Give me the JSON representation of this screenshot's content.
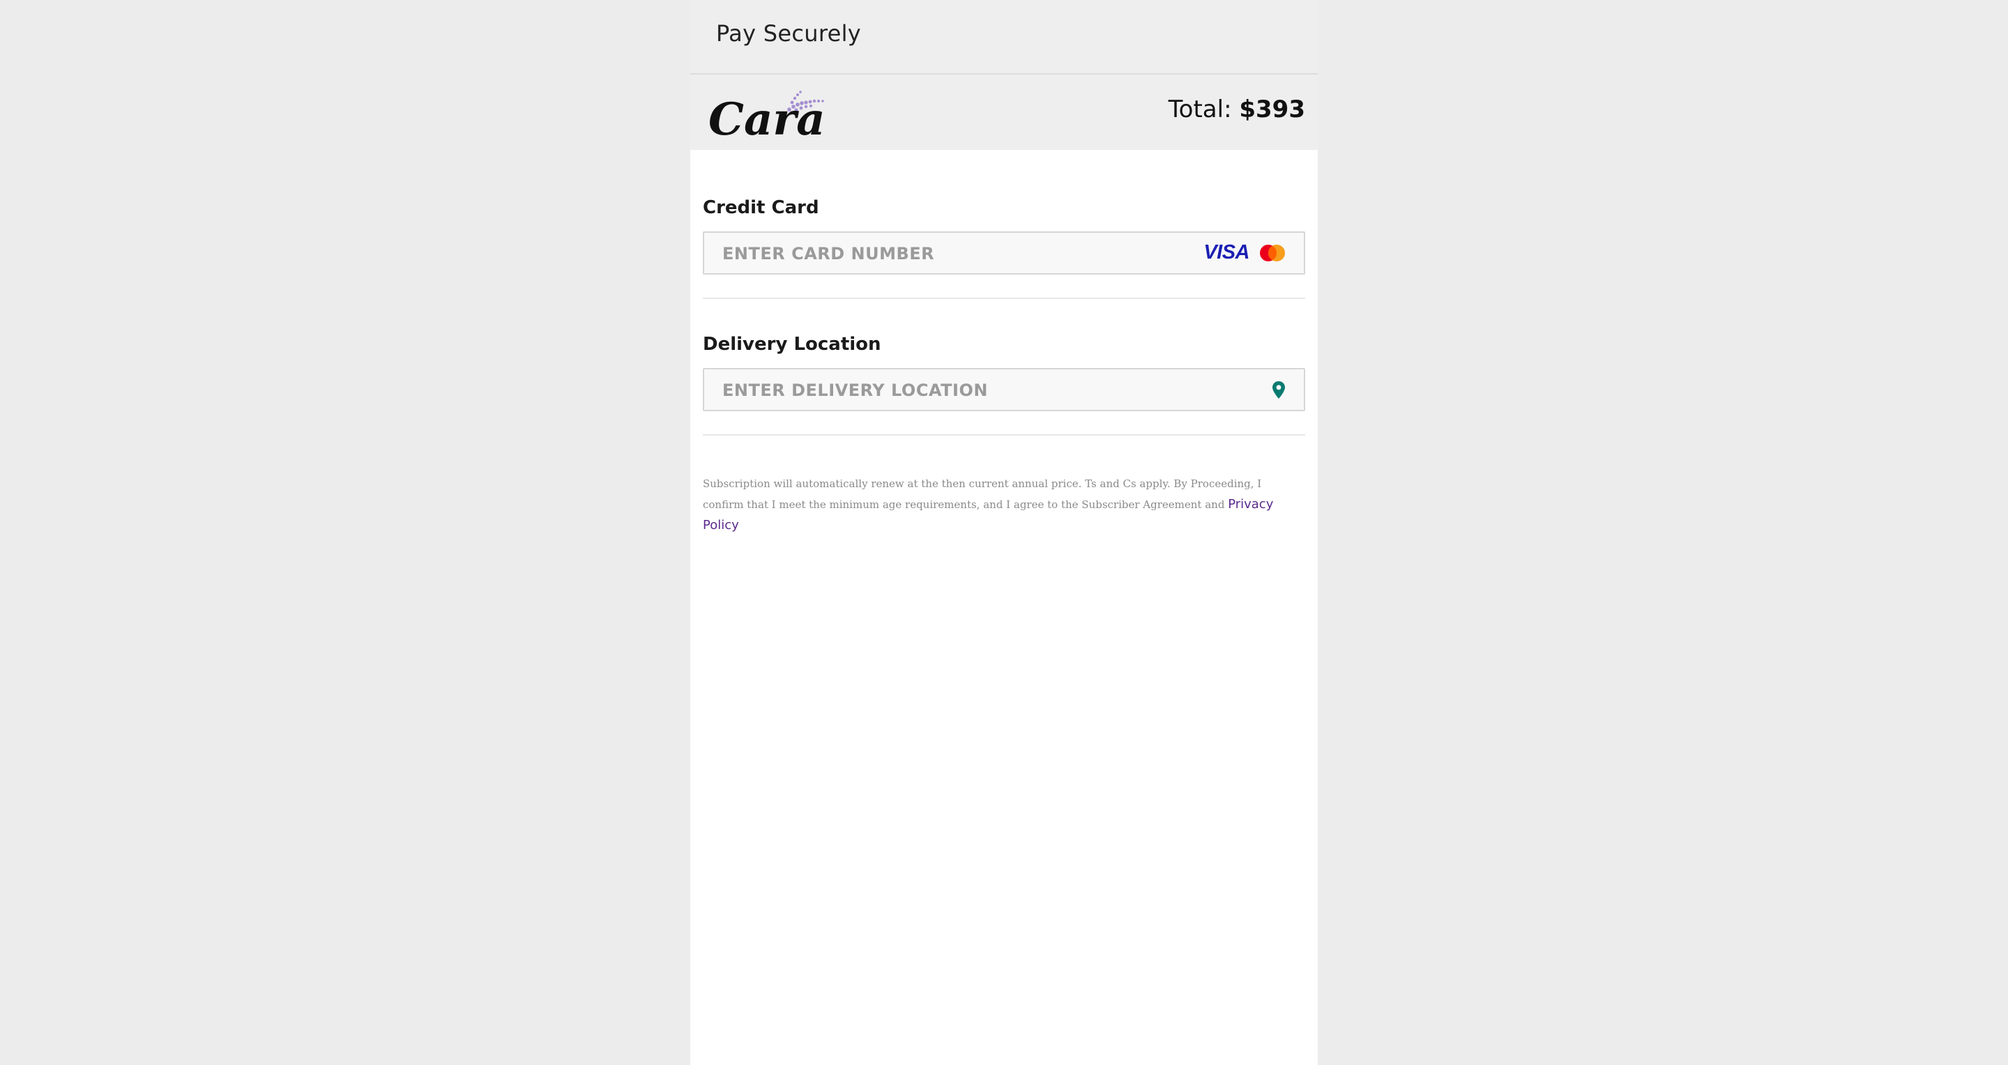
{
  "header": {
    "title": "Pay Securely"
  },
  "brand": {
    "logo_text": "Cara",
    "total_label": "Total:",
    "total_amount": "$393"
  },
  "credit_card": {
    "label": "Credit Card",
    "placeholder": "ENTER CARD NUMBER",
    "value": "",
    "brands": [
      "VISA",
      "mastercard"
    ],
    "visa_text": "VISA"
  },
  "delivery": {
    "label": "Delivery Location",
    "placeholder": "ENTER DELIVERY LOCATION",
    "value": "",
    "icon": "location-pin-icon"
  },
  "legal": {
    "text": "Subscription will automatically renew at the then current annual price. Ts and Cs apply. By Proceeding, I confirm that I meet the minimum age requirements, and I agree to the Subscriber Agreement and ",
    "privacy_link": "Privacy Policy"
  },
  "colors": {
    "page_background": "#ececec",
    "bar_background": "#eeeeee",
    "visa_blue": "#1a1fb3",
    "pin_teal": "#0b7b70",
    "link_purple": "#5b2a8c"
  }
}
